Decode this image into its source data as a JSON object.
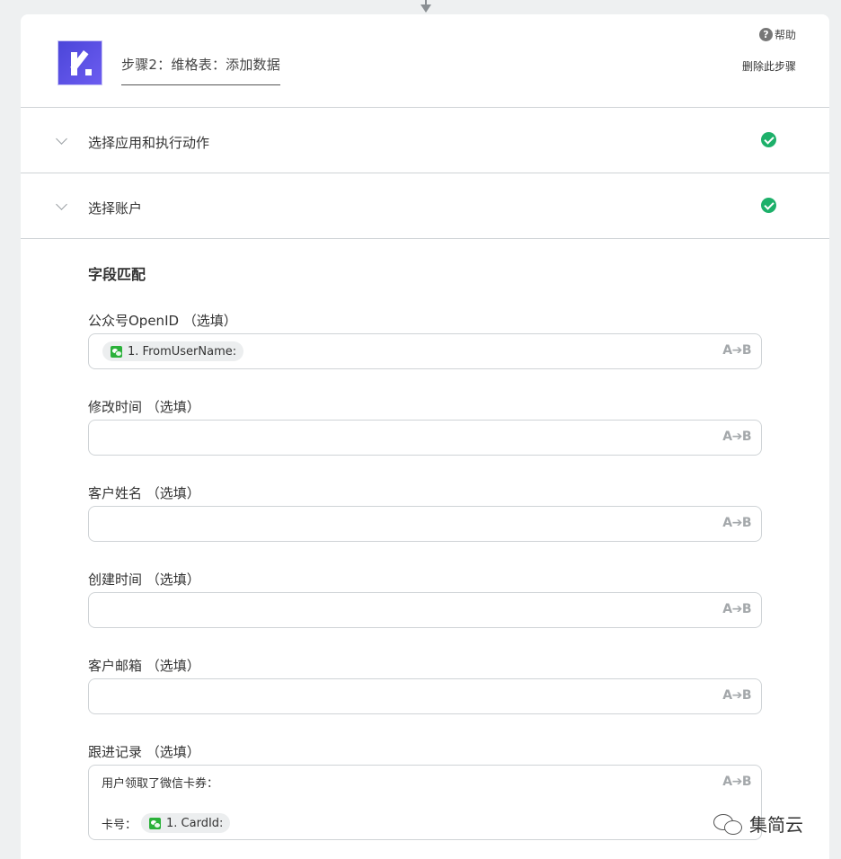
{
  "header": {
    "step_title": "步骤2：维格表：添加数据",
    "help_label": "帮助",
    "help_icon": "?",
    "delete_label": "删除此步骤"
  },
  "sections": [
    {
      "label": "选择应用和执行动作",
      "status": "complete"
    },
    {
      "label": "选择账户",
      "status": "complete"
    }
  ],
  "mapping": {
    "title": "字段匹配",
    "ab_icon": "A➔B",
    "fields": [
      {
        "label": "公众号OpenID （选填）",
        "token": "1. FromUserName:"
      },
      {
        "label": "修改时间 （选填）"
      },
      {
        "label": "客户姓名 （选填）"
      },
      {
        "label": "创建时间 （选填）"
      },
      {
        "label": "客户邮箱 （选填）"
      },
      {
        "label": "跟进记录 （选填）",
        "text_line": "用户领取了微信卡券：",
        "prefix": "卡号：",
        "token": "1. CardId:"
      }
    ]
  },
  "watermark": {
    "text": "集简云"
  },
  "colors": {
    "accent_green": "#1db06a",
    "logo_purple": "#4b46d9",
    "wechat_green": "#2bb13a"
  }
}
